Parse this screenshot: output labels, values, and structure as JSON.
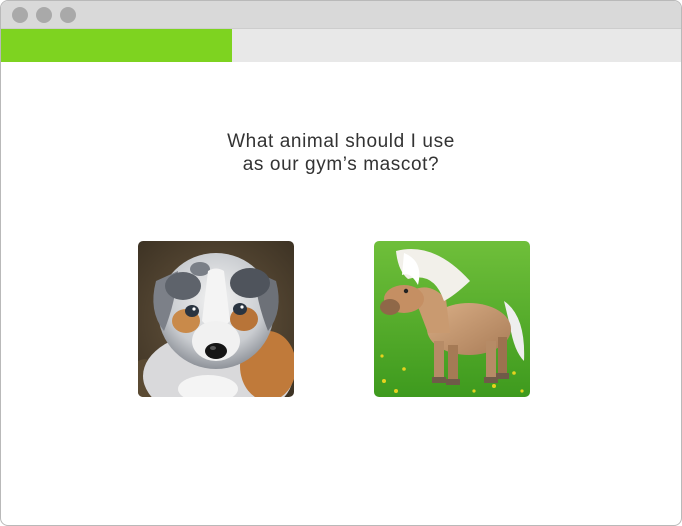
{
  "window": {
    "controls": [
      "close",
      "minimize",
      "maximize"
    ]
  },
  "progress": {
    "value_percent": 34,
    "fill_color": "#7ed320",
    "track_color": "#e8e8e8"
  },
  "question": {
    "line1": "What animal should I use",
    "line2": "as our gym’s mascot?"
  },
  "options": [
    {
      "icon": "puppy-photo"
    },
    {
      "icon": "pony-photo"
    }
  ]
}
